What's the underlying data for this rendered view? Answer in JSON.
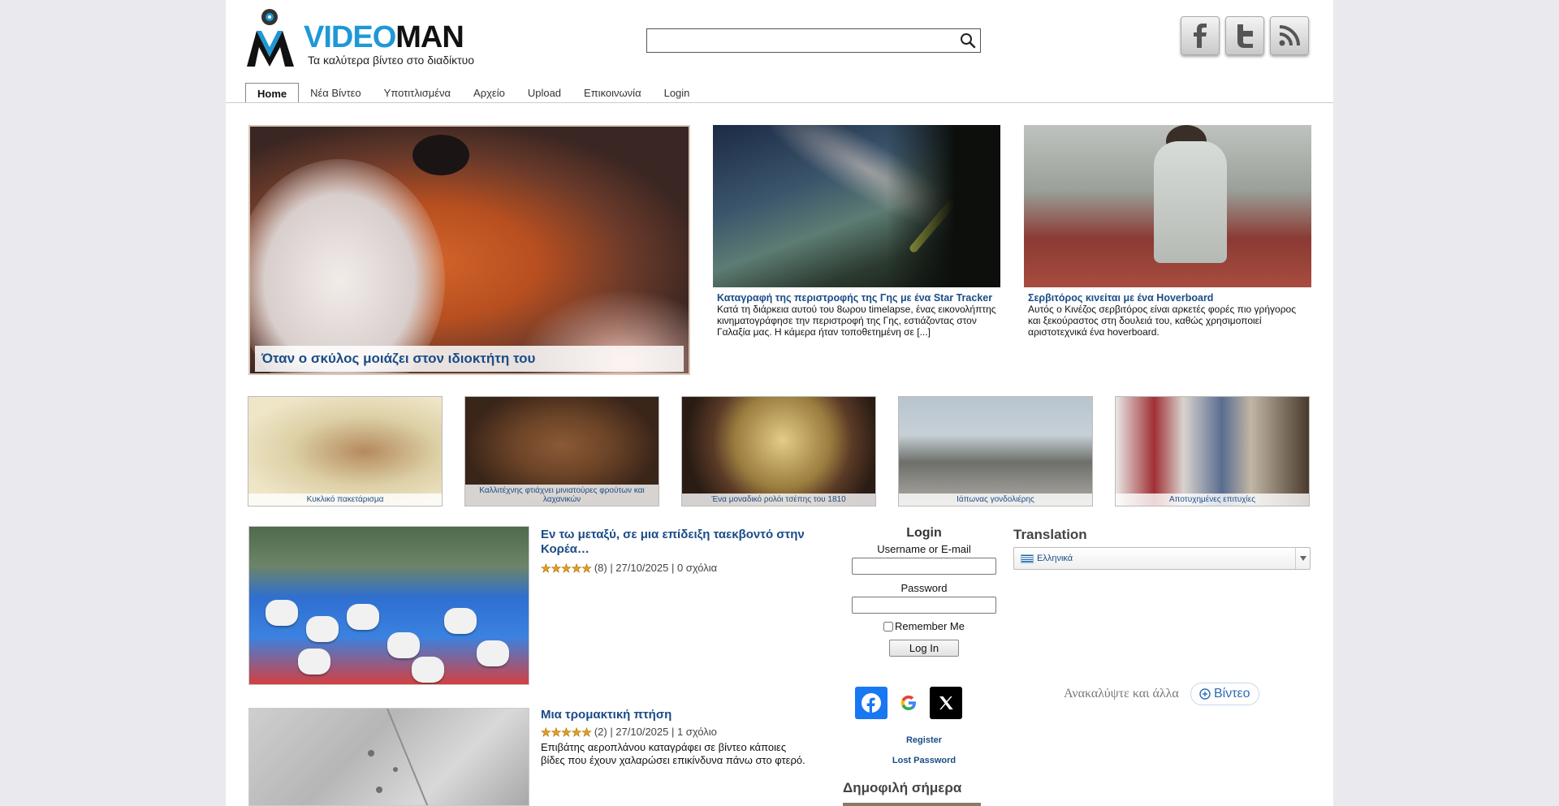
{
  "brand": {
    "logo_part1": "VIDEO",
    "logo_part2": "MAN",
    "tagline": "Τα καλύτερα βίντεο στο διαδίκτυο"
  },
  "search": {
    "value": "",
    "placeholder": ""
  },
  "social": [
    "facebook-icon",
    "twitter-icon",
    "rss-icon"
  ],
  "nav": {
    "items": [
      "Home",
      "Νέα Βίντεο",
      "Υποτιτλισμένα",
      "Αρχείο",
      "Upload",
      "Επικοινωνία",
      "Login"
    ],
    "active": "Home"
  },
  "hero": {
    "title": "Όταν ο σκύλος μοιάζει στον ιδιοκτήτη του"
  },
  "featured": [
    {
      "title": "Καταγραφή της περιστροφής της Γης με ένα Star Tracker",
      "desc": "Κατά τη διάρκεια αυτού του 8ωρου timelapse, ένας εικονολήπτης κινηματογράφησε την περιστροφή της Γης, εστιάζοντας στον Γαλαξία μας. Η κάμερα ήταν τοποθετημένη σε [...]"
    },
    {
      "title": "Σερβιτόρος κινείται με ένα Hoverboard",
      "desc": "Αυτός ο Κινέζος σερβιτόρος είναι αρκετές φορές πιο γρήγορος και ξεκούραστος στη δουλειά του, καθώς χρησιμοποιεί αριστοτεχνικά ένα hoverboard."
    }
  ],
  "thumbs": [
    "Κυκλικό πακετάρισμα",
    "Καλλιτέχνης φτιάχνει μινιατούρες φρούτων και λαχανικών",
    "Ένα μοναδικό ρολόι τσέπης του 1810",
    "Ιάπωνας γονδολιέρης",
    "Αποτυχημένες επιτυχίες"
  ],
  "posts": [
    {
      "title": "Εν τω μεταξύ, σε μια επίδειξη ταεκβοντό στην Κορέα…",
      "meta": "(8) | 27/10/2025 | 0 σχόλια",
      "stars": 5,
      "desc": ""
    },
    {
      "title": "Μια τρομακτική πτήση",
      "meta": "(2) | 27/10/2025 | 1 σχόλιο",
      "stars": 5,
      "desc": "Επιβάτης αεροπλάνου καταγράφει σε βίντεο κάποιες βίδες που έχουν χαλαρώσει επικίνδυνα πάνω στο φτερό."
    }
  ],
  "login": {
    "title": "Login",
    "username_label": "Username or E-mail",
    "username_value": "",
    "password_label": "Password",
    "password_value": "",
    "remember_label": "Remember Me",
    "remember_checked": false,
    "submit_label": "Log In",
    "social_logins": [
      "facebook-icon",
      "google-icon",
      "x-icon"
    ],
    "register_label": "Register",
    "lost_password_label": "Lost Password"
  },
  "popular": {
    "title": "Δημοφιλή σήμερα"
  },
  "translation": {
    "title": "Translation",
    "selected": "Ελληνικά"
  },
  "discover": {
    "text": "Ανακαλύψτε και άλλα",
    "button": "Βίντεο"
  },
  "colors": {
    "accent": "#1e98d6",
    "link": "#1a4c86",
    "star": "#e6a21a",
    "background": "#e9e9ee"
  }
}
